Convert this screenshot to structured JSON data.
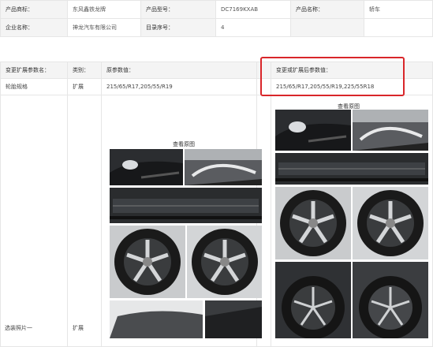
{
  "info": {
    "brand_label": "产品商标：",
    "brand_value": "东风鑫铁龙牌",
    "model_label": "产品型号：",
    "model_value": "DC7169KXAB",
    "name_label": "产品名称：",
    "name_value": "轿车",
    "company_label": "企业名称：",
    "company_value": "神龙汽车有限公司",
    "catalog_label": "目录序号：",
    "catalog_value": "4"
  },
  "change": {
    "col_param": "变更扩展参数名：",
    "col_type": "类别：",
    "col_original": "原参数值：",
    "col_new": "变更或扩展后参数值：",
    "row_param": "轮胎规格",
    "row_type": "扩展",
    "row_original": "215/65/R17,205/55/R19",
    "row_new": "215/65/R17,205/55/R19,225/55R18",
    "photo_param": "选装照片一",
    "photo_type": "扩展",
    "view_original_left": "查看原图",
    "view_original_right": "查看原图"
  },
  "colors": {
    "highlight_border": "#d9262a",
    "label_bg": "#f4f4f4"
  }
}
